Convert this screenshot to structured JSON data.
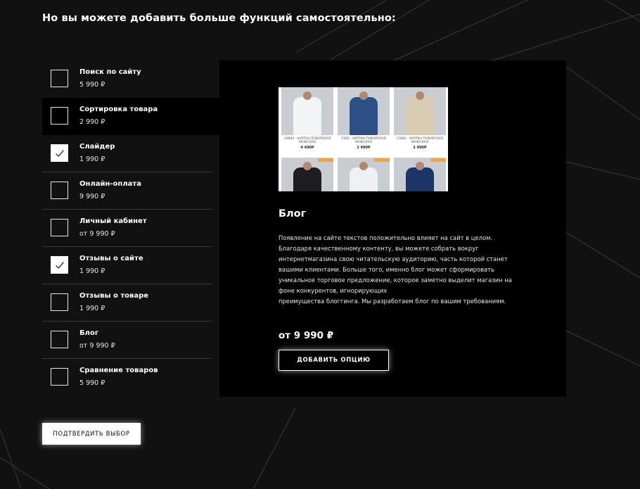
{
  "heading": "Но вы можете добавить больше функций самостоятельно:",
  "options": [
    {
      "title": "Поиск по сайту",
      "price": "5 990 ₽",
      "checked": false
    },
    {
      "title": "Сортировка товара",
      "price": "2 990 ₽",
      "checked": false,
      "active": true
    },
    {
      "title": "Слайдер",
      "price": "1 990 ₽",
      "checked": true
    },
    {
      "title": "Онлайн-оплата",
      "price": "9 990 ₽",
      "checked": false
    },
    {
      "title": "Личный кабинет",
      "price": "от 9 990 ₽",
      "checked": false
    },
    {
      "title": "Отзывы о сайте",
      "price": "1 990 ₽",
      "checked": true
    },
    {
      "title": "Отзывы о товаре",
      "price": "1 990 ₽",
      "checked": false
    },
    {
      "title": "Блог",
      "price": "от 9 990 ₽",
      "checked": false
    },
    {
      "title": "Сравнение товаров",
      "price": "5 990 ₽",
      "checked": false
    }
  ],
  "panel": {
    "preview_products": [
      {
        "caption": "1989А - КУРТКА ПОВАРСКАЯ МУЖСКАЯ",
        "price": "4 490Р",
        "color": "#f3f4f6"
      },
      {
        "caption": "2385 - КУРТКА ПОВАРСКАЯ МУЖСКАЯ",
        "price": "2 990Р",
        "color": "#2c4f86"
      },
      {
        "caption": "2389L - КУРТКА ПОВАРСКАЯ МУЖСКАЯ",
        "price": "2 990Р",
        "color": "#d9ccb2"
      },
      {
        "caption": "",
        "price": "",
        "color": "#1e1e22"
      },
      {
        "caption": "",
        "price": "",
        "color": "#eef0f3"
      },
      {
        "caption": "",
        "price": "",
        "color": "#1d3566"
      }
    ],
    "title": "Блог",
    "description_lines": [
      "Появление на сайте текстов положительно влияет на сайт в целом.",
      "Благодаря качественному  контенту, вы можете собрать вокруг",
      "интернетмагазина свою читательскую аудиторию, часть которой станет",
      "вашими клиентами. Больше того, именно блог может сформировать",
      "уникальное торговое предложение, которое заметно выделит магазин на",
      "фоне конкурентов, игнорирующих",
      "преимущества блоггинга. Мы разработаем блог по вашим требованиям."
    ],
    "price": "от 9 990 ₽",
    "add_button": "ДОБАВИТЬ ОПЦИЮ"
  },
  "confirm_button": "ПОДТВЕРДИТЬ ВЫБОР",
  "colors": {
    "background": "#111112",
    "panel": "#000000",
    "accent": "#ffffff",
    "tag": "#f0a640"
  }
}
